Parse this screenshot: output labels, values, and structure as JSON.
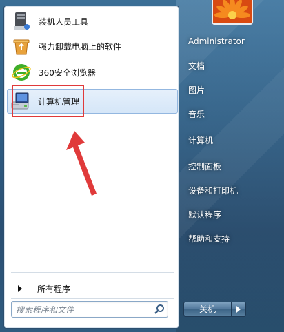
{
  "pinned": [
    {
      "label": "装机人员工具",
      "icon": "toolkit-icon"
    },
    {
      "label": "强力卸载电脑上的软件",
      "icon": "recycle-bin-icon"
    },
    {
      "label": "360安全浏览器",
      "icon": "browser-360-icon"
    },
    {
      "label": "计算机管理",
      "icon": "computer-management-icon"
    }
  ],
  "all_programs_label": "所有程序",
  "search": {
    "placeholder": "搜索程序和文件"
  },
  "right": {
    "user": "Administrator",
    "items": [
      "文档",
      "图片",
      "音乐",
      "计算机",
      "控制面板",
      "设备和打印机",
      "默认程序",
      "帮助和支持"
    ]
  },
  "shutdown_label": "关机",
  "colors": {
    "annotation": "#e03a3a",
    "accent": "#2f5f86"
  }
}
